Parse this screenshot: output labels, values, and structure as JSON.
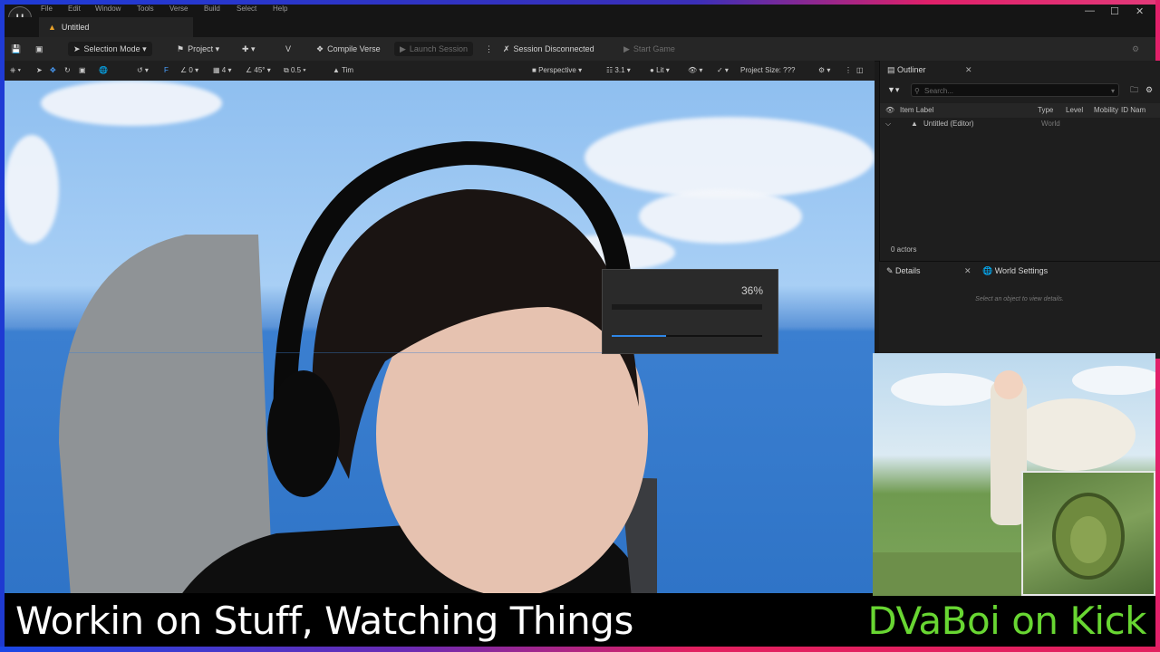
{
  "window": {
    "menu": [
      "File",
      "Edit",
      "Window",
      "Tools",
      "Verse",
      "Build",
      "Select",
      "Help"
    ],
    "doc_tab": "Untitled",
    "controls": [
      "—",
      "☐",
      "✕"
    ]
  },
  "toolbar": {
    "selection_mode": "Selection Mode",
    "project": "Project",
    "compile_verse": "Compile Verse",
    "launch_session": "Launch Session",
    "session_status": "Session Disconnected",
    "start_game": "Start Game"
  },
  "viewport_bar": {
    "snap_rotate": "0",
    "grid": "4",
    "angle": "45°",
    "scale": "0.5",
    "time_label": "Tim",
    "perspective": "Perspective",
    "fov": "3.1",
    "lit": "Lit",
    "project_size": "Project Size: ???"
  },
  "progress": {
    "percent_label": "36%",
    "fraction": 0.36
  },
  "outliner": {
    "tab": "Outliner",
    "search_placeholder": "Search...",
    "columns": {
      "item_label": "Item Label",
      "type": "Type",
      "level": "Level",
      "mobility": "Mobility",
      "id_name": "ID Nam"
    },
    "rows": [
      {
        "label": "Untitled (Editor)",
        "type": "World"
      }
    ],
    "actors_count": "0 actors"
  },
  "details": {
    "tab": "Details",
    "world_settings_tab": "World Settings",
    "empty_message": "Select an object to view details."
  },
  "overlay": {
    "caption_left": "Workin on  Stuff, Watching Things",
    "caption_right": "DVaBoi on Kick"
  },
  "colors": {
    "accent_blue": "#2e86e6",
    "kick_green": "#68d632",
    "frame_blue": "#1f3bd6",
    "frame_pink": "#e2206a"
  }
}
